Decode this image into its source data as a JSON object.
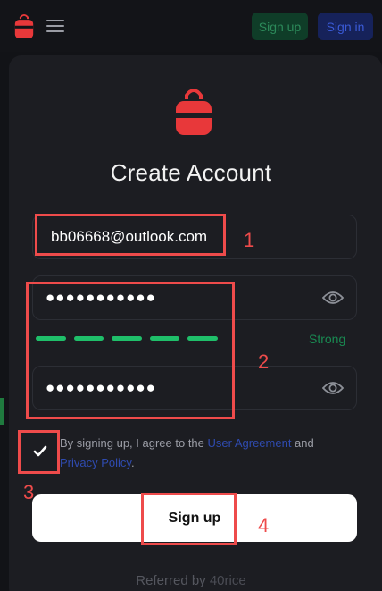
{
  "nav": {
    "signup_label": "Sign up",
    "signin_label": "Sign in",
    "logo_icon": "backpack-icon",
    "menu_icon": "hamburger-menu-icon"
  },
  "form": {
    "title": "Create Account",
    "email_value": "bb06668@outlook.com",
    "password_value": "●●●●●●●●●●●",
    "confirm_password_value": "●●●●●●●●●●●",
    "strength_label": "Strong",
    "agree_prefix": "By signing up, I agree to the ",
    "user_agreement": "User Agreement",
    "agree_and": " and",
    "privacy_policy": "Privacy Policy",
    "agree_suffix": ".",
    "submit_label": "Sign up",
    "referred_prefix": "Referred by ",
    "referral_code": "40rice"
  },
  "annotations": [
    "1",
    "2",
    "3",
    "4"
  ],
  "colors": {
    "background": "#121317",
    "card": "#1c1d22",
    "brand_red": "#e8383a",
    "strength_green": "#1fbf6a",
    "link_blue": "#2f4bb0",
    "annotation_red": "#ee4b4b"
  }
}
